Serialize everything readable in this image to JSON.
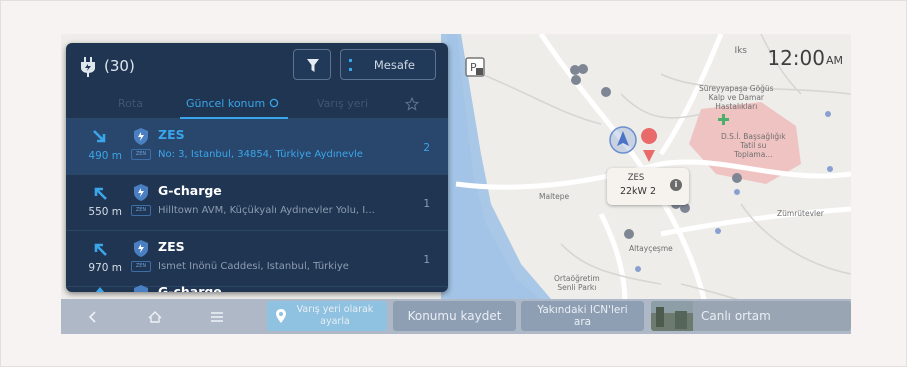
{
  "panel": {
    "charger_count": "(30)",
    "sort_label": "Mesafe",
    "tabs": [
      "Rota",
      "Güncel konum",
      "Varış yeri"
    ],
    "results": [
      {
        "distance": "490 m",
        "name": "ZES",
        "address": "No: 3, İstanbul, 34854, Türkiye  Aydınevle",
        "count": "2",
        "arrow": "arrow-down-right",
        "selected": true
      },
      {
        "distance": "550 m",
        "name": "G-charge",
        "address": "Hilltown AVM, Küçükyalı Aydınevler Yolu, İ...",
        "count": "1",
        "arrow": "arrow-up-left",
        "selected": false
      },
      {
        "distance": "970 m",
        "name": "ZES",
        "address": "İsmet İnönü Caddesi, İstanbul, Türkiye",
        "count": "1",
        "arrow": "arrow-up-left",
        "selected": false
      },
      {
        "distance": "",
        "name": "G-charge",
        "address": "",
        "count": "",
        "arrow": "arrow-up",
        "selected": false
      }
    ],
    "badge_label": "ZEN"
  },
  "status": {
    "time": "12:00",
    "ampm": "AM",
    "small": "Iks"
  },
  "callout": {
    "name": "ZES",
    "power": "22kW 2",
    "info": "i"
  },
  "map_places": {
    "hospital": "Süreyyapaşa Göğüs\nKalp ve Damar\nHastalıkları",
    "hospital2": "D.S.İ. Başsağlığık\nTatil su\nToplama...",
    "maltepe": "Maltepe",
    "zumrutevler": "Zümrütevler",
    "altaycesme": "Altayçeşme",
    "ortaogretim": "Ortaöğretim\nSenli Parkı"
  },
  "bottom": {
    "dest": "Varış yeri olarak ayarla",
    "save": "Konumu kaydet",
    "nearby": "Yakındaki ICN'leri ara",
    "street": "Canlı ortam"
  },
  "colors": {
    "panel": "#1f3552",
    "accent": "#3aa6ea",
    "pin": "#e96a6a"
  }
}
